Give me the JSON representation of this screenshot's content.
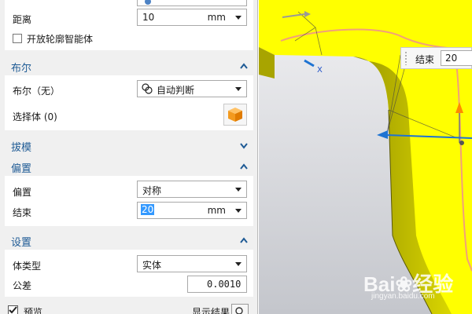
{
  "top_partial": {
    "distance_label": "距离",
    "distance_value": "10",
    "distance_unit": "mm",
    "release_checkbox": "开放轮廓智能体"
  },
  "boolean_section": {
    "title": "布尔",
    "bool_label": "布尔（无）",
    "bool_value": "自动判断",
    "select_body_label": "选择体 (0)"
  },
  "draft_section": {
    "title": "拔模"
  },
  "offset_section": {
    "title": "偏置",
    "offset_label": "偏置",
    "offset_value": "对称",
    "end_label": "结束",
    "end_value": "20",
    "end_unit": "mm"
  },
  "settings_section": {
    "title": "设置",
    "body_type_label": "体类型",
    "body_type_value": "实体",
    "tolerance_label": "公差",
    "tolerance_value": "0.0010"
  },
  "bottom_partial": {
    "preview_label": "预览",
    "show_result_label": "显示结果"
  },
  "viewport": {
    "end_handle_label": "结束",
    "end_handle_value": "20",
    "axis_x_label": "X"
  },
  "watermark": {
    "brand": "Bai❀经验",
    "url": "jingyan.baidu.com"
  },
  "colors": {
    "section_title": "#1f5b95",
    "model_yellow": "#ffff00",
    "accent_blue": "#1e73d2"
  }
}
